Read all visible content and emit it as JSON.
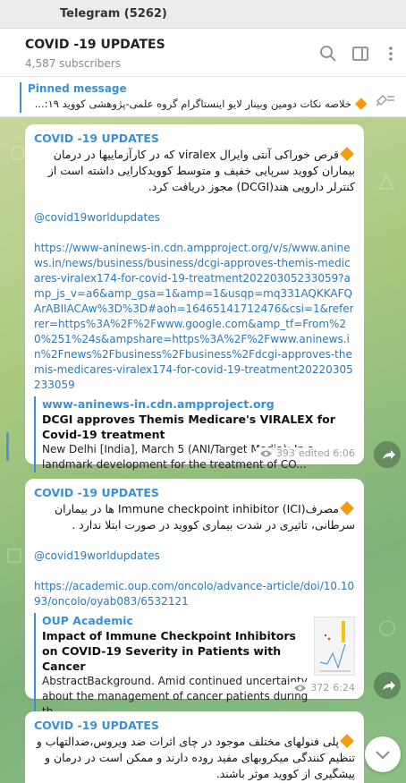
{
  "window": {
    "title": "Telegram (5262)"
  },
  "header": {
    "channel": "COVID -19 UPDATES",
    "subscribers": "4,587 subscribers",
    "icons": [
      "search-icon",
      "sidebar-toggle-icon",
      "more-vert-icon"
    ]
  },
  "pinned": {
    "label": "Pinned message",
    "text": "🔶 خلاصه نکات دومین وبینار لایو اینستاگرام گروه علمی-پژوهشی کووید ۱۹:...",
    "icon": "unpin-list-icon"
  },
  "messages": [
    {
      "author": "COVID -19 UPDATES",
      "text": "قرص خوراکی آنتی وایرال viralex که در کارآزماییها در درمان بیماران کووید سرپایی خفیف و متوسط کوویدکارایی داشته است از کنترلر دارویی هند(DCGI) مجوز دریافت کرد.",
      "mention": "@covid19worldupdates",
      "url": "https://www-aninews-in.cdn.ampproject.org/v/s/www.aninews.in/news/business/business/dcgi-approves-themis-medicares-viralex174-for-covid-19-treatment20220305233059?amp_js_v=a6&amp_gsa=1&amp=1&usqp=mq331AQKKAFQArABIIACAw%3D%3D#aoh=16465141712476&csi=1&referrer=https%3A%2F%2Fwww.google.com&amp_tf=From%20%251%24s&ampshare=https%3A%2F%2Fwww.aninews.in%2Fnews%2Fbusiness%2Fbusiness%2Fdcgi-approves-themis-medicares-viralex174-for-covid-19-treatment20220305233059",
      "preview": {
        "site": "www-aninews-in.cdn.ampproject.org",
        "title": "DCGI approves Themis Medicare's VIRALEX for Covid-19 treatment",
        "desc": "New Delhi [India], March 5 (ANI/Target Media): In a landmark development for the treatment of CO..."
      },
      "views": "393",
      "time": "edited 6:06"
    },
    {
      "author": "COVID -19 UPDATES",
      "text": "مصرف(Immune checkpoint inhibitor (ICI ها در بیماران سرطانی، تاثیری در شدت بیماری کووید در صورت ابتلا  ندارد .",
      "mention": "@covid19worldupdates",
      "url": "https://academic.oup.com/oncolo/advance-article/doi/10.1093/oncolo/oyab083/6532121",
      "preview": {
        "site": "OUP Academic",
        "title": "Impact of Immune Checkpoint Inhibitors on COVID-19 Severity in Patients with Cancer",
        "desc": "AbstractBackground. Amid continued uncertainty about the management of cancer patients during th..."
      },
      "views": "372",
      "time": "6:24"
    },
    {
      "author": "COVID -19 UPDATES",
      "text": "پلی فنولهای مختلف موجود در چای اثرات ضد ویروس،ضدالتهاب و تنظیم کنندگی میکروبهای مفید روده دارند و ممکن است در درمان و پیشگیری از کووید موثر باشند."
    }
  ],
  "colors": {
    "accent": "#3a8fd6",
    "chat_bg": "#a8c97e",
    "emoji": "#f39c12"
  }
}
